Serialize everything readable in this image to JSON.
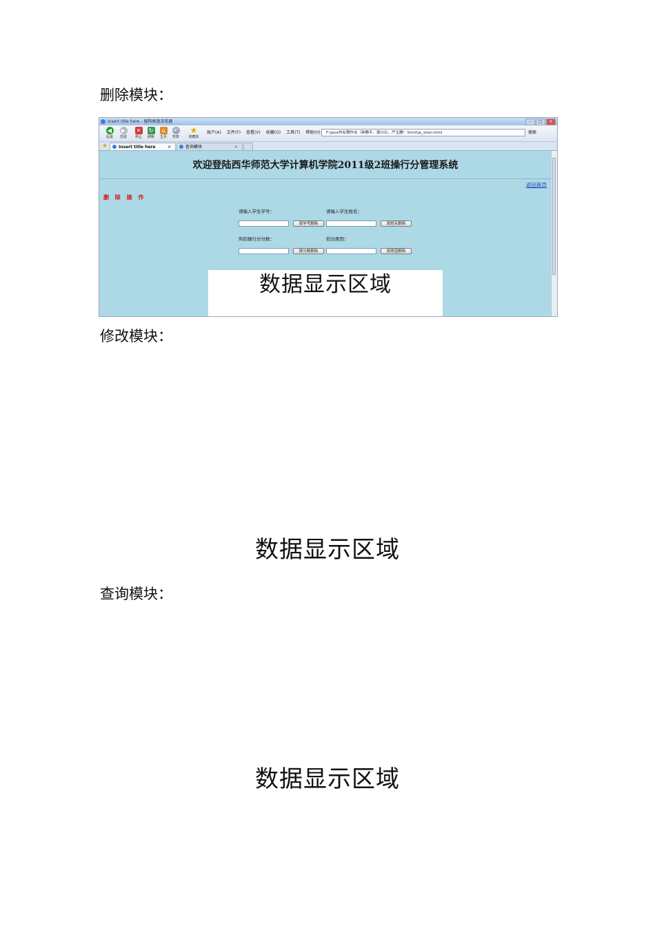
{
  "sections": {
    "delete_heading": "删除模块：",
    "modify_heading": "修改模块：",
    "query_heading": "查询模块：",
    "modify_area_label": "数据显示区域",
    "query_area_label": "数据显示区域"
  },
  "browser": {
    "window_title": "Insert title here - 搜狗高速浏览器",
    "toolbar": {
      "back": "后退",
      "forward": "前进",
      "stop": "停止",
      "refresh": "刷新",
      "home": "主页",
      "restore": "恢复",
      "favorites": "收藏夹"
    },
    "menus": [
      "账户(A)",
      "文件(F)",
      "查看(V)",
      "收藏(O)",
      "工具(T)",
      "帮助(H)"
    ],
    "address": "F:\\java作业期作业（钟静平、周沙沁、严玉静）\\html\\ja_shan.html",
    "go_label": "搜索",
    "tabs": [
      {
        "label": "Insert title here",
        "active": true
      },
      {
        "label": "查询模块",
        "active": false
      }
    ]
  },
  "page": {
    "title": "欢迎登陆西华师范大学计算机学院2011级2班操行分管理系统",
    "home_link": "返回首页",
    "operation_title": "删 除 操 作",
    "form": {
      "student_id_label": "请输入学生学号：",
      "student_name_label": "请输入学生姓名：",
      "score_label": "所扣操行分分数：",
      "reason_label": "扣分原因：",
      "delete_by_id_button": "按学号删除",
      "delete_by_name_button": "按姓名删除",
      "delete_by_score_button": "按分数删除",
      "delete_by_reason_button": "按原因删除"
    },
    "data_area_label": "数据显示区域"
  }
}
